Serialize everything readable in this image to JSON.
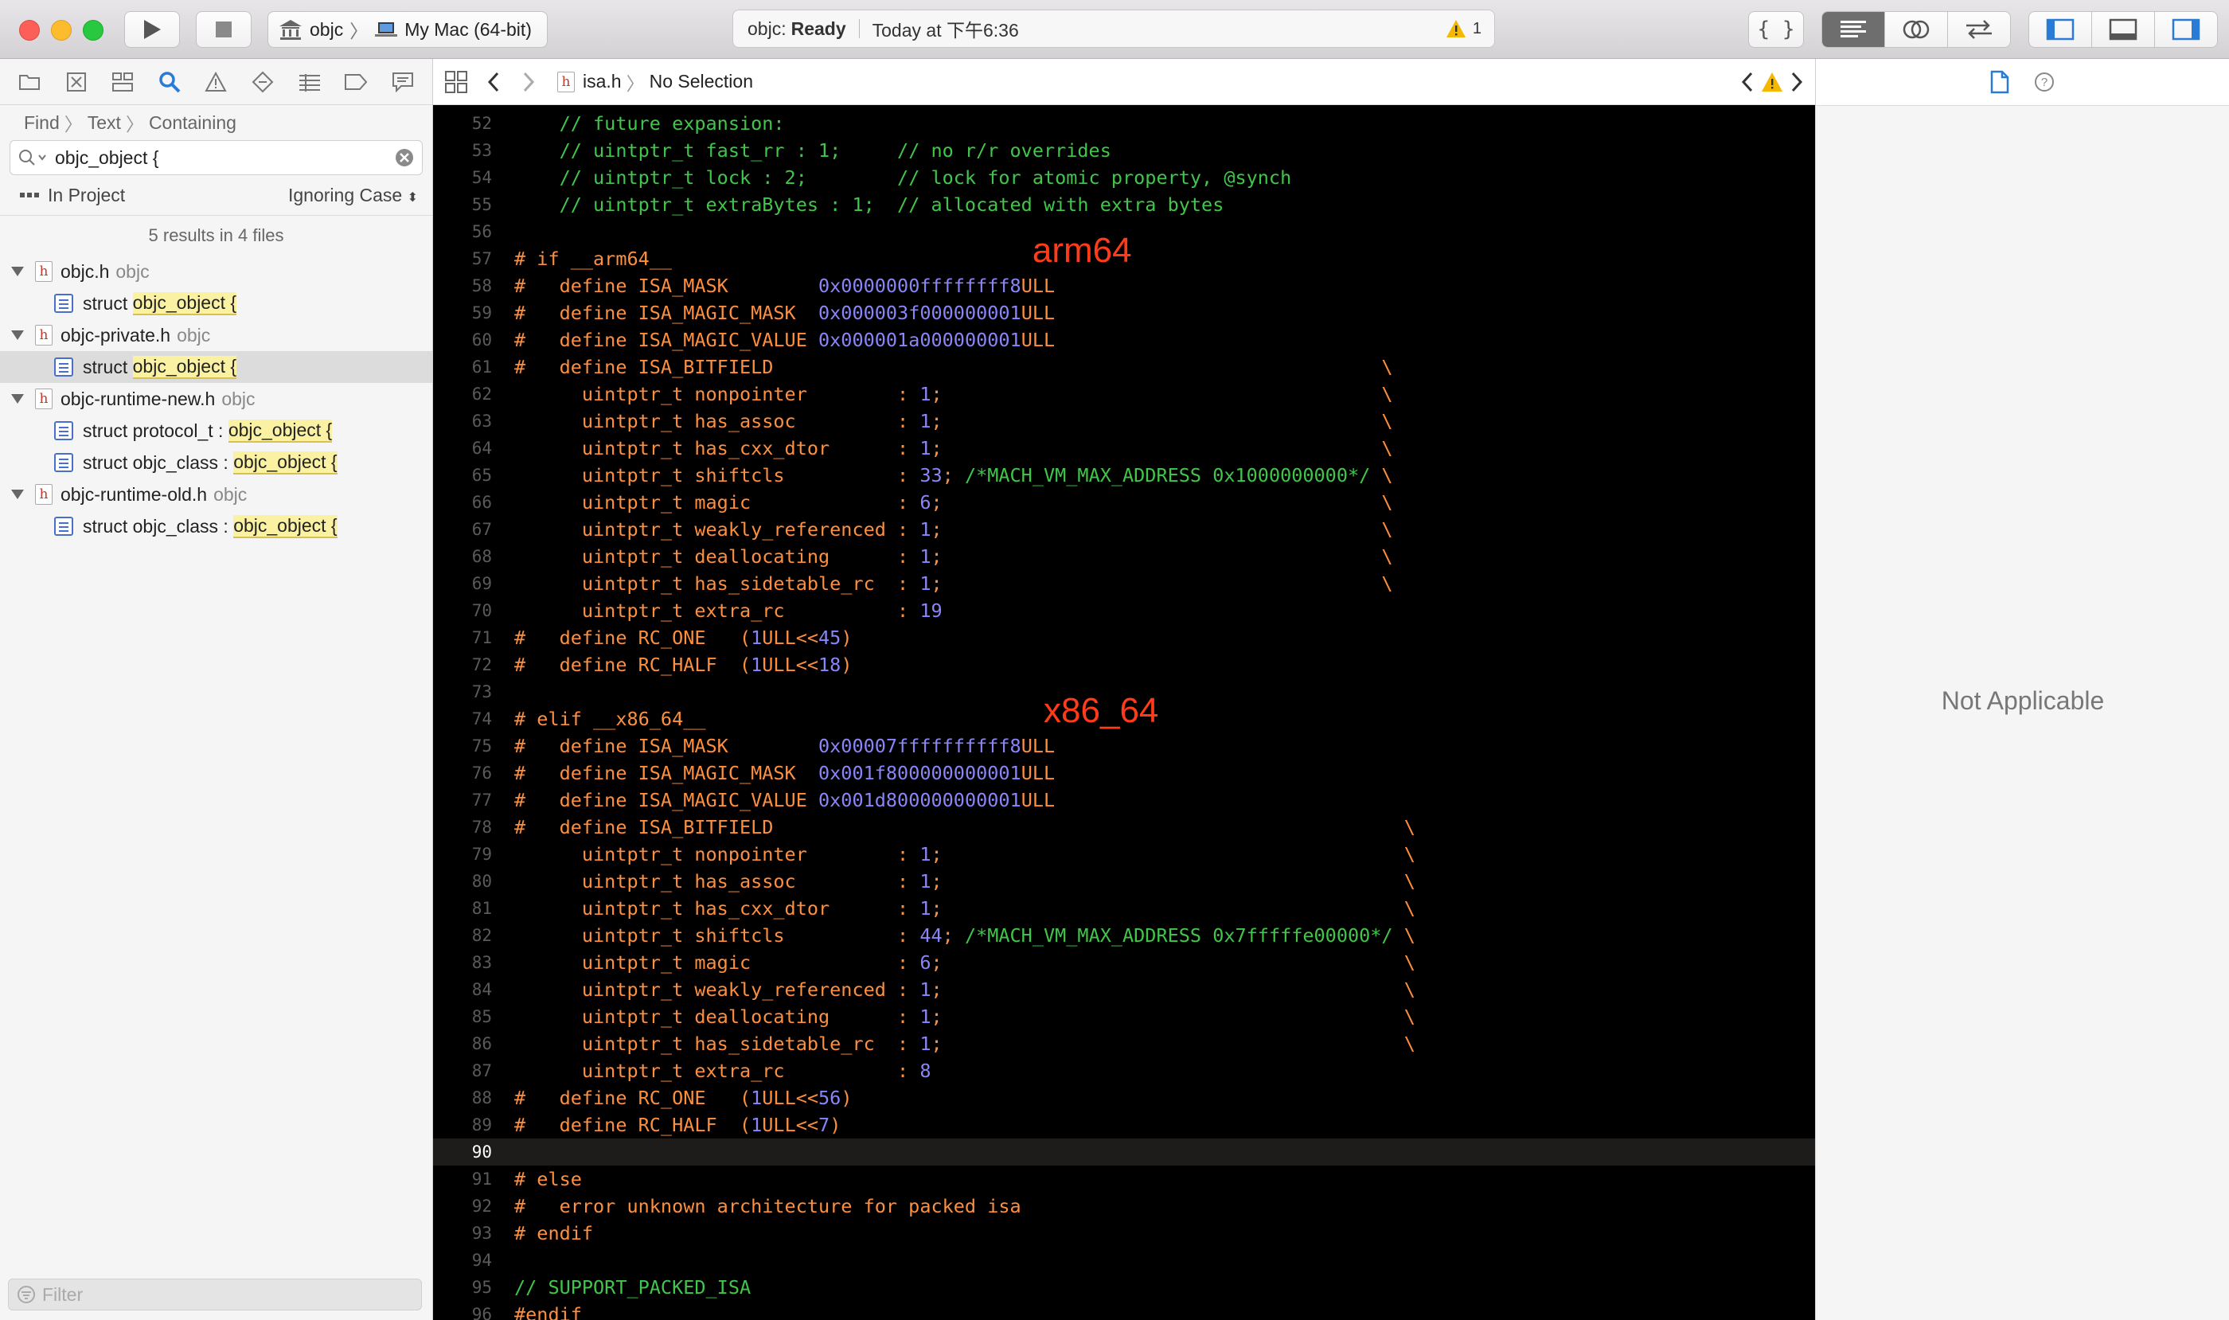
{
  "toolbar": {
    "scheme_project": "objc",
    "scheme_destination": "My Mac (64-bit)",
    "activity_scheme": "objc:",
    "activity_status": "Ready",
    "activity_time": "Today at 下午6:36",
    "warning_count": "1"
  },
  "navigator": {
    "find_crumbs": [
      "Find",
      "Text",
      "Containing"
    ],
    "search_value": "objc_object {",
    "scope": "In Project",
    "case_mode": "Ignoring Case",
    "summary": "5 results in 4 files",
    "files": [
      {
        "name": "objc.h",
        "target": "objc",
        "results": [
          {
            "prefix": "struct ",
            "match": "objc_object {",
            "selected": false
          }
        ]
      },
      {
        "name": "objc-private.h",
        "target": "objc",
        "results": [
          {
            "prefix": "struct ",
            "match": "objc_object {",
            "selected": true
          }
        ]
      },
      {
        "name": "objc-runtime-new.h",
        "target": "objc",
        "results": [
          {
            "prefix": "struct protocol_t : ",
            "match": "objc_object {",
            "selected": false
          },
          {
            "prefix": "struct objc_class : ",
            "match": "objc_object {",
            "selected": false
          }
        ]
      },
      {
        "name": "objc-runtime-old.h",
        "target": "objc",
        "results": [
          {
            "prefix": "struct objc_class : ",
            "match": "objc_object {",
            "selected": false
          }
        ]
      }
    ],
    "filter_placeholder": "Filter"
  },
  "jumpbar": {
    "file": "isa.h",
    "selection": "No Selection"
  },
  "editor": {
    "current_line": 90,
    "annotations": [
      {
        "text": "arm64",
        "line": 57
      },
      {
        "text": "x86_64",
        "line": 74
      }
    ],
    "lines": [
      {
        "n": 52,
        "t": "    // future expansion:"
      },
      {
        "n": 53,
        "t": "    // uintptr_t fast_rr : 1;     // no r/r overrides"
      },
      {
        "n": 54,
        "t": "    // uintptr_t lock : 2;        // lock for atomic property, @synch"
      },
      {
        "n": 55,
        "t": "    // uintptr_t extraBytes : 1;  // allocated with extra bytes"
      },
      {
        "n": 56,
        "t": ""
      },
      {
        "n": 57,
        "t": "# if __arm64__"
      },
      {
        "n": 58,
        "t": "#   define ISA_MASK        0x0000000ffffffff8ULL"
      },
      {
        "n": 59,
        "t": "#   define ISA_MAGIC_MASK  0x000003f000000001ULL"
      },
      {
        "n": 60,
        "t": "#   define ISA_MAGIC_VALUE 0x000001a000000001ULL"
      },
      {
        "n": 61,
        "t": "#   define ISA_BITFIELD                                                      \\"
      },
      {
        "n": 62,
        "t": "      uintptr_t nonpointer        : 1;                                       \\"
      },
      {
        "n": 63,
        "t": "      uintptr_t has_assoc         : 1;                                       \\"
      },
      {
        "n": 64,
        "t": "      uintptr_t has_cxx_dtor      : 1;                                       \\"
      },
      {
        "n": 65,
        "t": "      uintptr_t shiftcls          : 33; /*MACH_VM_MAX_ADDRESS 0x1000000000*/ \\"
      },
      {
        "n": 66,
        "t": "      uintptr_t magic             : 6;                                       \\"
      },
      {
        "n": 67,
        "t": "      uintptr_t weakly_referenced : 1;                                       \\"
      },
      {
        "n": 68,
        "t": "      uintptr_t deallocating      : 1;                                       \\"
      },
      {
        "n": 69,
        "t": "      uintptr_t has_sidetable_rc  : 1;                                       \\"
      },
      {
        "n": 70,
        "t": "      uintptr_t extra_rc          : 19"
      },
      {
        "n": 71,
        "t": "#   define RC_ONE   (1ULL<<45)"
      },
      {
        "n": 72,
        "t": "#   define RC_HALF  (1ULL<<18)"
      },
      {
        "n": 73,
        "t": ""
      },
      {
        "n": 74,
        "t": "# elif __x86_64__"
      },
      {
        "n": 75,
        "t": "#   define ISA_MASK        0x00007ffffffffff8ULL"
      },
      {
        "n": 76,
        "t": "#   define ISA_MAGIC_MASK  0x001f800000000001ULL"
      },
      {
        "n": 77,
        "t": "#   define ISA_MAGIC_VALUE 0x001d800000000001ULL"
      },
      {
        "n": 78,
        "t": "#   define ISA_BITFIELD                                                        \\"
      },
      {
        "n": 79,
        "t": "      uintptr_t nonpointer        : 1;                                         \\"
      },
      {
        "n": 80,
        "t": "      uintptr_t has_assoc         : 1;                                         \\"
      },
      {
        "n": 81,
        "t": "      uintptr_t has_cxx_dtor      : 1;                                         \\"
      },
      {
        "n": 82,
        "t": "      uintptr_t shiftcls          : 44; /*MACH_VM_MAX_ADDRESS 0x7fffffe00000*/ \\"
      },
      {
        "n": 83,
        "t": "      uintptr_t magic             : 6;                                         \\"
      },
      {
        "n": 84,
        "t": "      uintptr_t weakly_referenced : 1;                                         \\"
      },
      {
        "n": 85,
        "t": "      uintptr_t deallocating      : 1;                                         \\"
      },
      {
        "n": 86,
        "t": "      uintptr_t has_sidetable_rc  : 1;                                         \\"
      },
      {
        "n": 87,
        "t": "      uintptr_t extra_rc          : 8"
      },
      {
        "n": 88,
        "t": "#   define RC_ONE   (1ULL<<56)"
      },
      {
        "n": 89,
        "t": "#   define RC_HALF  (1ULL<<7)"
      },
      {
        "n": 90,
        "t": ""
      },
      {
        "n": 91,
        "t": "# else"
      },
      {
        "n": 92,
        "t": "#   error unknown architecture for packed isa"
      },
      {
        "n": 93,
        "t": "# endif"
      },
      {
        "n": 94,
        "t": ""
      },
      {
        "n": 95,
        "t": "// SUPPORT_PACKED_ISA"
      },
      {
        "n": 96,
        "t": "#endif"
      }
    ]
  },
  "inspector": {
    "empty_message": "Not Applicable"
  },
  "colors": {
    "comment": "#41c64b",
    "preprocessor": "#fd8f3f",
    "number": "#8a86f8",
    "annotation": "#ff3b1a"
  }
}
